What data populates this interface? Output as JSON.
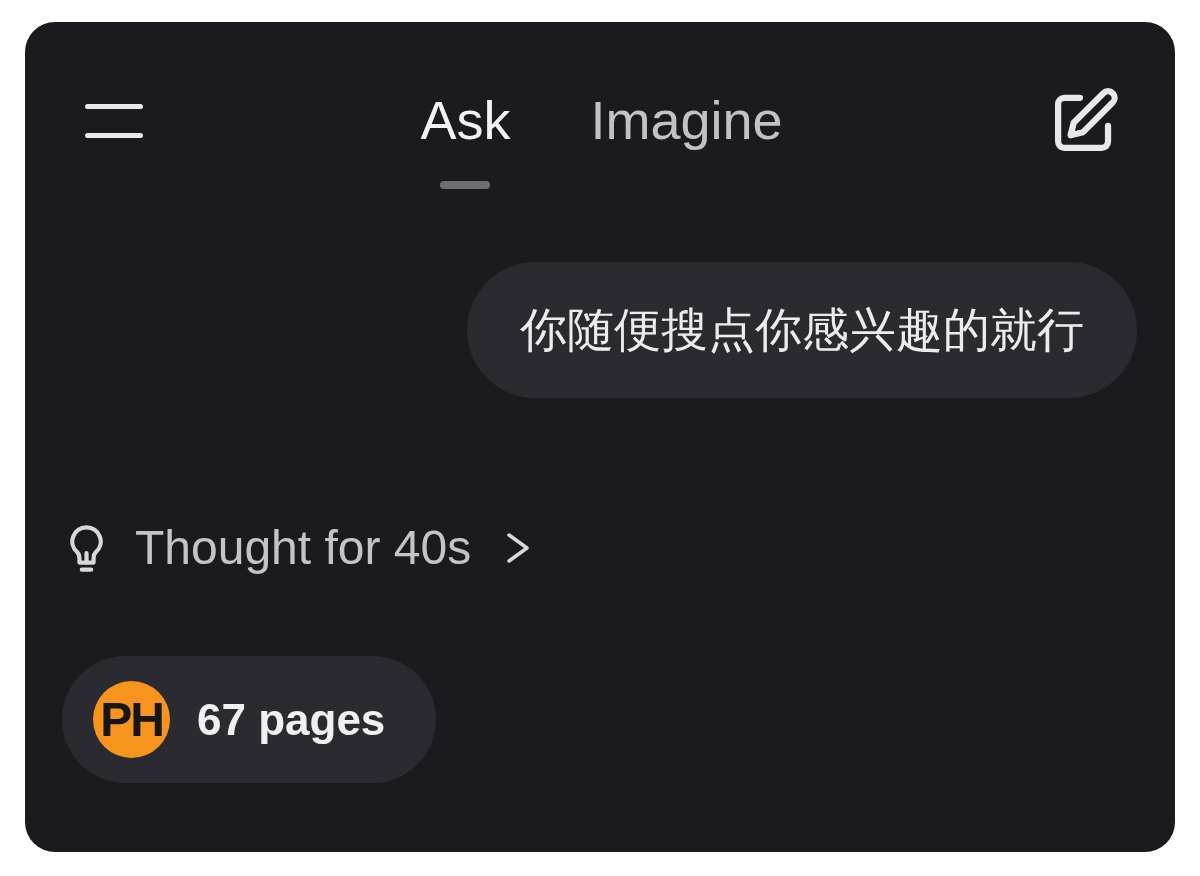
{
  "tabs": [
    {
      "label": "Ask",
      "selected": true
    },
    {
      "label": "Imagine",
      "selected": false
    }
  ],
  "user_message": {
    "text": "你随便搜点你感兴趣的就行"
  },
  "thought": {
    "label": "Thought for 40s"
  },
  "sources": {
    "avatar": "PH",
    "label": "67 pages"
  }
}
